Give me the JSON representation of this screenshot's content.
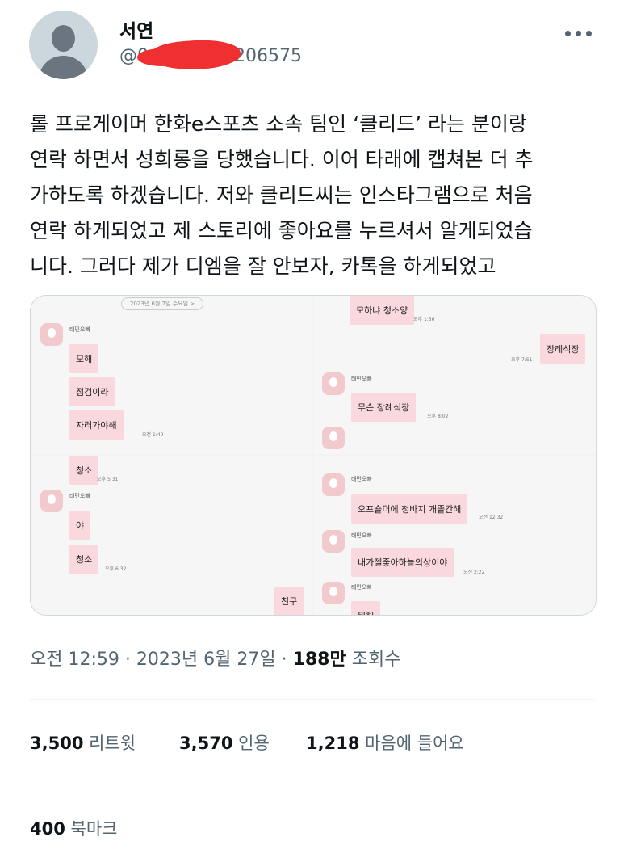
{
  "author": {
    "name": "서연",
    "handle": "@0   206575",
    "handle_prefix": "@0",
    "handle_suffix": "206575"
  },
  "tweet": {
    "lines": [
      "롤 프로게이머 한화e스포츠 소속 팀인 ‘클리드’ 라는 분이랑",
      "연락 하면서 성희롱을 당했습니다. 이어 타래에 캡쳐본 더 추",
      "가하도록 하겠습니다. 저와 클리드씨는 인스타그램으로 처음",
      "연락 하게되었고 제 스토리에 좋아요를 누르셔서 알게되었습",
      "니다. 그러다 제가 디엠을 잘 안보자, 카톡을 하게되었고"
    ]
  },
  "media": {
    "date_pill": "2023년 6월 7일 수요일 >",
    "sender": "태민오빠",
    "panel1": {
      "bubbles": [
        "모해",
        "점검이라",
        "자러가야해"
      ],
      "time": "오전 1:40"
    },
    "panel2": {
      "bubble_top": "모하냐 청소양",
      "time_top": "오후 1:56",
      "reply": "장례식장",
      "reply_time": "오후 7:51",
      "bubble": "무슨 장례식장",
      "time": "오후 8:02"
    },
    "panel3": {
      "bubble_top": "청소",
      "time_top": "오후 5:31",
      "bubbles": [
        "야",
        "청소"
      ],
      "time": "오후 6:32",
      "reply": "친구"
    },
    "panel4": {
      "bubble1": "오프숄더에 청바지 개졸간해",
      "time1": "오전 12:32",
      "bubble2": "내가젤좋아하늘의상이야",
      "time2": "오전 2:22",
      "bubble3": "뭐해"
    }
  },
  "meta": {
    "time": "오전 12:59",
    "date": "2023년 6월 27일",
    "views_count": "188만",
    "views_label": "조회수"
  },
  "stats": {
    "retweets": {
      "count": "3,500",
      "label": "리트윗"
    },
    "quotes": {
      "count": "3,570",
      "label": "인용"
    },
    "likes": {
      "count": "1,218",
      "label": "마음에 들어요"
    },
    "bookmarks": {
      "count": "400",
      "label": "북마크"
    }
  },
  "colors": {
    "redaction": "#f03030",
    "bubble": "#f9d9dd",
    "muted": "#536471"
  }
}
